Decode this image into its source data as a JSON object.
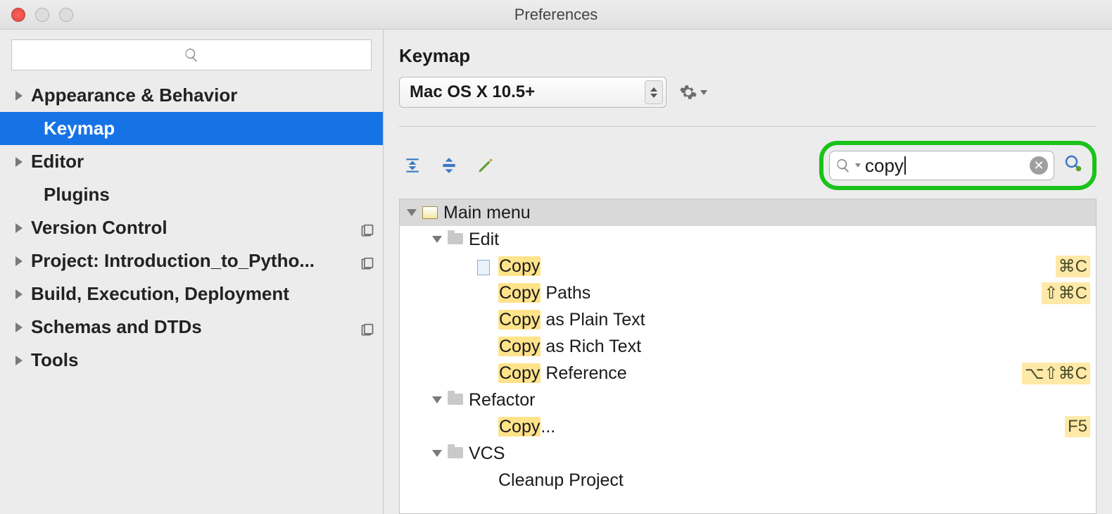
{
  "window": {
    "title": "Preferences"
  },
  "sidebar": {
    "items": [
      {
        "label": "Appearance & Behavior",
        "hasArrow": true
      },
      {
        "label": "Keymap",
        "selected": true,
        "indent": true
      },
      {
        "label": "Editor",
        "hasArrow": true
      },
      {
        "label": "Plugins",
        "indent": true
      },
      {
        "label": "Version Control",
        "hasArrow": true,
        "folderIcon": true
      },
      {
        "label": "Project: Introduction_to_Pytho...",
        "hasArrow": true,
        "folderIcon": true
      },
      {
        "label": "Build, Execution, Deployment",
        "hasArrow": true
      },
      {
        "label": "Schemas and DTDs",
        "hasArrow": true,
        "folderIcon": true
      },
      {
        "label": "Tools",
        "hasArrow": true
      }
    ]
  },
  "main": {
    "heading": "Keymap",
    "scheme": "Mac OS X 10.5+",
    "search": {
      "value": "copy"
    }
  },
  "tree": {
    "root": "Main menu",
    "groups": [
      {
        "label": "Edit",
        "items": [
          {
            "hl": "Copy",
            "rest": "",
            "shortcut": "⌘C",
            "fileIcon": true
          },
          {
            "hl": "Copy",
            "rest": " Paths",
            "shortcut": "⇧⌘C"
          },
          {
            "hl": "Copy",
            "rest": " as Plain Text"
          },
          {
            "hl": "Copy",
            "rest": " as Rich Text"
          },
          {
            "hl": "Copy",
            "rest": " Reference",
            "shortcut": "⌥⇧⌘C"
          }
        ]
      },
      {
        "label": "Refactor",
        "items": [
          {
            "hl": "Copy",
            "rest": "...",
            "shortcut": "F5"
          }
        ]
      },
      {
        "label": "VCS",
        "items": [
          {
            "hl": "",
            "rest": "Cleanup Project"
          }
        ]
      }
    ]
  }
}
